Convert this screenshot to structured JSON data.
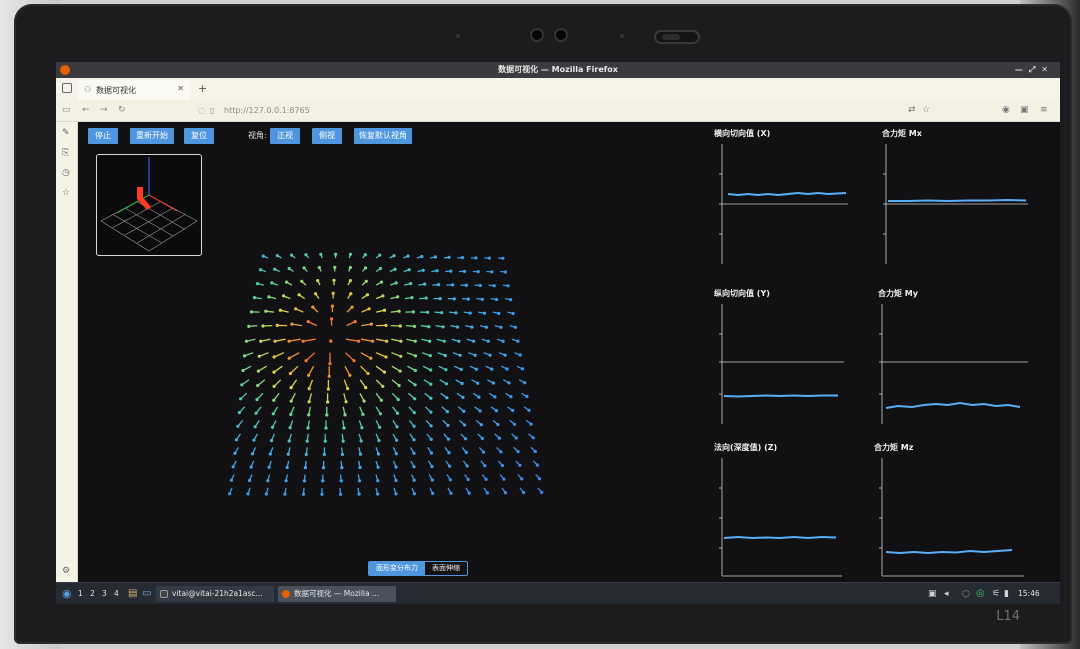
{
  "window": {
    "title": "数据可视化 — Mozilla Firefox",
    "controls": [
      "—",
      "⤢",
      "✕"
    ]
  },
  "browser": {
    "tab_title": "数据可视化",
    "url": "http://127.0.0.1:8765"
  },
  "toolbar": {
    "stop_label": "停止",
    "restart_label": "重新开始",
    "reset_label": "复位",
    "view_label": "视角:",
    "front_label": "正视",
    "side_label": "侧视",
    "default_view_label": "恢复默认视角"
  },
  "plots": [
    {
      "id": "x",
      "title": "横向切向值 (X)"
    },
    {
      "id": "mx",
      "title": "合力矩 Mx"
    },
    {
      "id": "y",
      "title": "纵向切向值 (Y)"
    },
    {
      "id": "my",
      "title": "合力矩 My"
    },
    {
      "id": "z",
      "title": "法向(深度值) (Z)"
    },
    {
      "id": "mz",
      "title": "合力矩 Mz"
    }
  ],
  "bottom_tabs": [
    "面形变分布力",
    "表面伸缩"
  ],
  "taskbar": {
    "workspaces": [
      "1",
      "2",
      "3",
      "4"
    ],
    "tasks": [
      {
        "label": "vitai@vitai-21h2a1asc..."
      },
      {
        "label": "数据可视化 — Mozilla ..."
      }
    ],
    "clock": "15:46"
  },
  "laptop_model": "L14",
  "colors": {
    "accent": "#4e97df",
    "plot_line": "#5aaef5",
    "page_bg": "#111114"
  }
}
